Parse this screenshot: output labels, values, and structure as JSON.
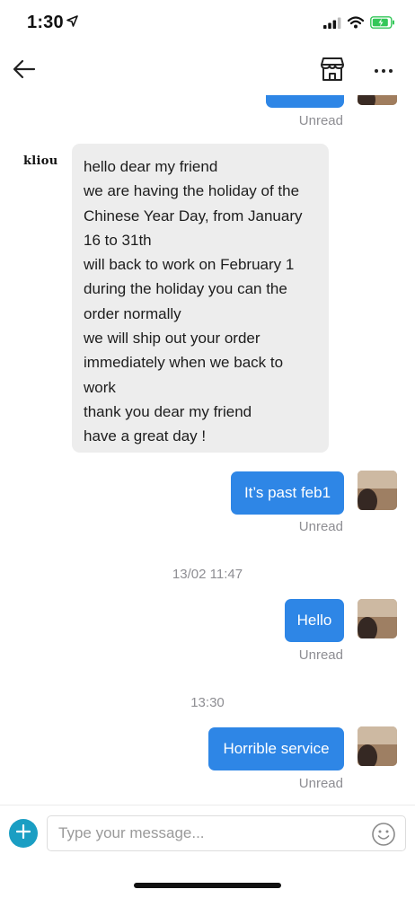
{
  "status_bar": {
    "time": "1:30"
  },
  "nav": {
    "back_icon": "arrow-left-icon",
    "store_icon": "store-icon",
    "more_icon": "more-horizontal-icon"
  },
  "seller": {
    "logo_text": "kliou"
  },
  "messages": [
    {
      "direction": "outgoing",
      "text": "",
      "status": "Unread"
    },
    {
      "direction": "incoming",
      "lines": [
        "hello dear my friend",
        "we are having the holiday of the",
        "Chinese Year Day, from January",
        "16 to 31th",
        "will back to work on February 1",
        "during the holiday you can the",
        "order normally",
        "we will ship out your order",
        "immediately when we back to",
        "work",
        "thank you dear my friend",
        "have a great day !"
      ]
    },
    {
      "direction": "outgoing",
      "text": "It’s past feb1",
      "status": "Unread"
    },
    {
      "separator": "13/02 11:47"
    },
    {
      "direction": "outgoing",
      "text": "Hello",
      "status": "Unread"
    },
    {
      "separator": "13:30"
    },
    {
      "direction": "outgoing",
      "text": "Horrible service",
      "status": "Unread"
    }
  ],
  "composer": {
    "placeholder": "Type your message...",
    "value": ""
  },
  "colors": {
    "outgoing_bubble": "#2e86e6",
    "incoming_bubble": "#ededed",
    "add_button": "#1a9ec3",
    "battery": "#34c759"
  }
}
